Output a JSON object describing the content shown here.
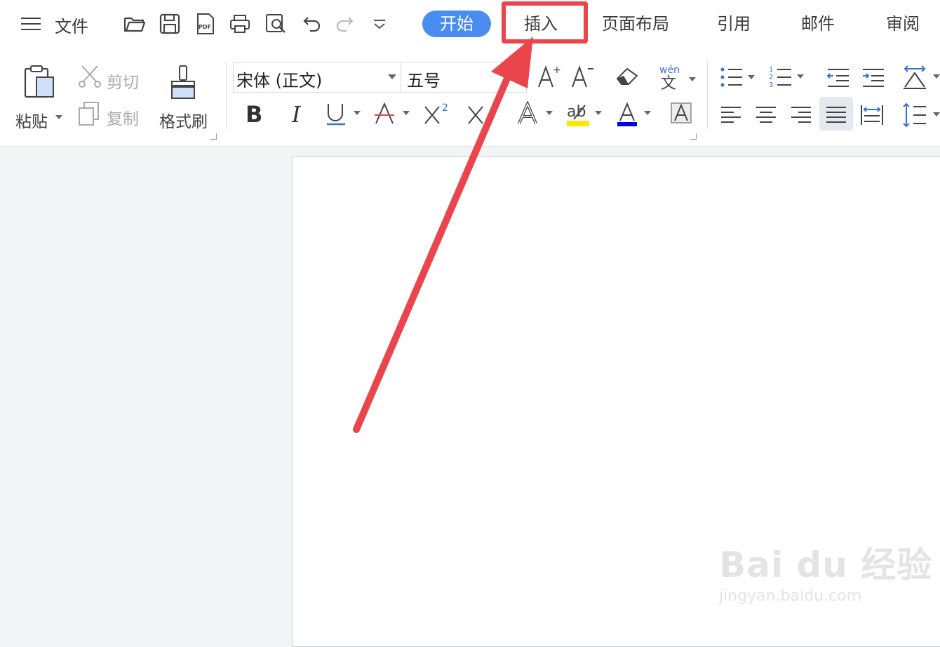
{
  "menu": {
    "file_label": "文件",
    "tabs": [
      "开始",
      "插入",
      "页面布局",
      "引用",
      "邮件",
      "审阅"
    ],
    "active_tab": "开始",
    "highlighted_tab": "插入"
  },
  "quick_access_icons": [
    "open-folder-icon",
    "save-icon",
    "export-pdf-icon",
    "print-icon",
    "print-preview-icon",
    "undo-icon",
    "redo-icon",
    "more-dropdown-icon"
  ],
  "clipboard": {
    "paste_label": "粘贴",
    "cut_label": "剪切",
    "copy_label": "复制",
    "format_painter_label": "格式刷"
  },
  "font": {
    "font_name": "宋体 (正文)",
    "font_size": "五号"
  },
  "font_buttons": [
    "B",
    "I",
    "U",
    "A",
    "X²",
    "X"
  ],
  "colors": {
    "accent": "#4a8df0",
    "highlight_box": "#e9454a",
    "highlight_yellow": "#ffe600",
    "font_color_blue": "#0000ee",
    "underline_blue": "#3a6fd8",
    "strike_red": "#e04040"
  },
  "watermark": {
    "brand": "Bai du 经验",
    "url": "jingyan.baidu.com"
  }
}
